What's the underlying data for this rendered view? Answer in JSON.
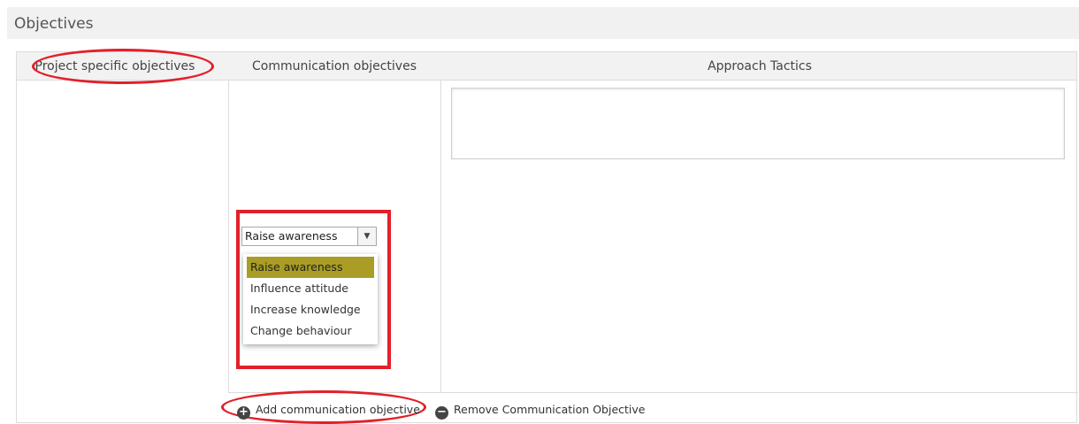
{
  "panel": {
    "title": "Objectives"
  },
  "table": {
    "headers": [
      "Project specific objectives",
      "Communication objectives",
      "Approach Tactics"
    ]
  },
  "objective_select": {
    "value": "Raise awareness",
    "options": [
      "Raise awareness",
      "Influence attitude",
      "Increase knowledge",
      "Change behaviour"
    ],
    "highlighted": "Raise awareness"
  },
  "actions": {
    "add": "Add communication objective",
    "remove": "Remove Communication Objective"
  },
  "colors": {
    "highlight": "#a99d25",
    "annotation": "#e2202a"
  }
}
